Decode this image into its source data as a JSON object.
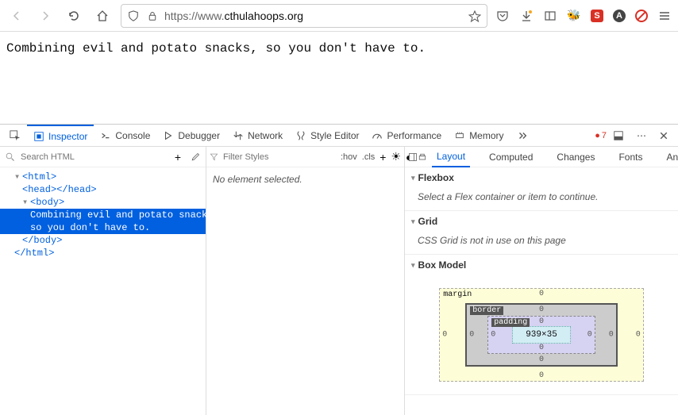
{
  "browser": {
    "url_prefix": "https://www.",
    "url_domain": "cthulahoops.org"
  },
  "page": {
    "body_text": "Combining evil and potato snacks, so you don't have to."
  },
  "devtools": {
    "tabs": {
      "inspector": "Inspector",
      "console": "Console",
      "debugger": "Debugger",
      "network": "Network",
      "style_editor": "Style Editor",
      "performance": "Performance",
      "memory": "Memory"
    },
    "error_count": "7",
    "search_placeholder": "Search HTML",
    "tree": {
      "html_open": "<html>",
      "head": "<head></head>",
      "body_open": "<body>",
      "body_text1": "Combining evil and potato snacks,",
      "body_text2": "so you don't have to.",
      "body_close": "</body>",
      "html_close": "</html>"
    },
    "styles": {
      "filter_placeholder": "Filter Styles",
      "hov": ":hov",
      "cls": ".cls",
      "no_element": "No element selected."
    },
    "layout": {
      "subtabs": {
        "layout": "Layout",
        "computed": "Computed",
        "changes": "Changes",
        "fonts": "Fonts",
        "animations": "Anim"
      },
      "flexbox": {
        "title": "Flexbox",
        "body": "Select a Flex container or item to continue."
      },
      "grid": {
        "title": "Grid",
        "body": "CSS Grid is not in use on this page"
      },
      "boxmodel": {
        "title": "Box Model",
        "margin_label": "margin",
        "border_label": "border",
        "padding_label": "padding",
        "content_size": "939×35",
        "zero": "0"
      }
    }
  }
}
